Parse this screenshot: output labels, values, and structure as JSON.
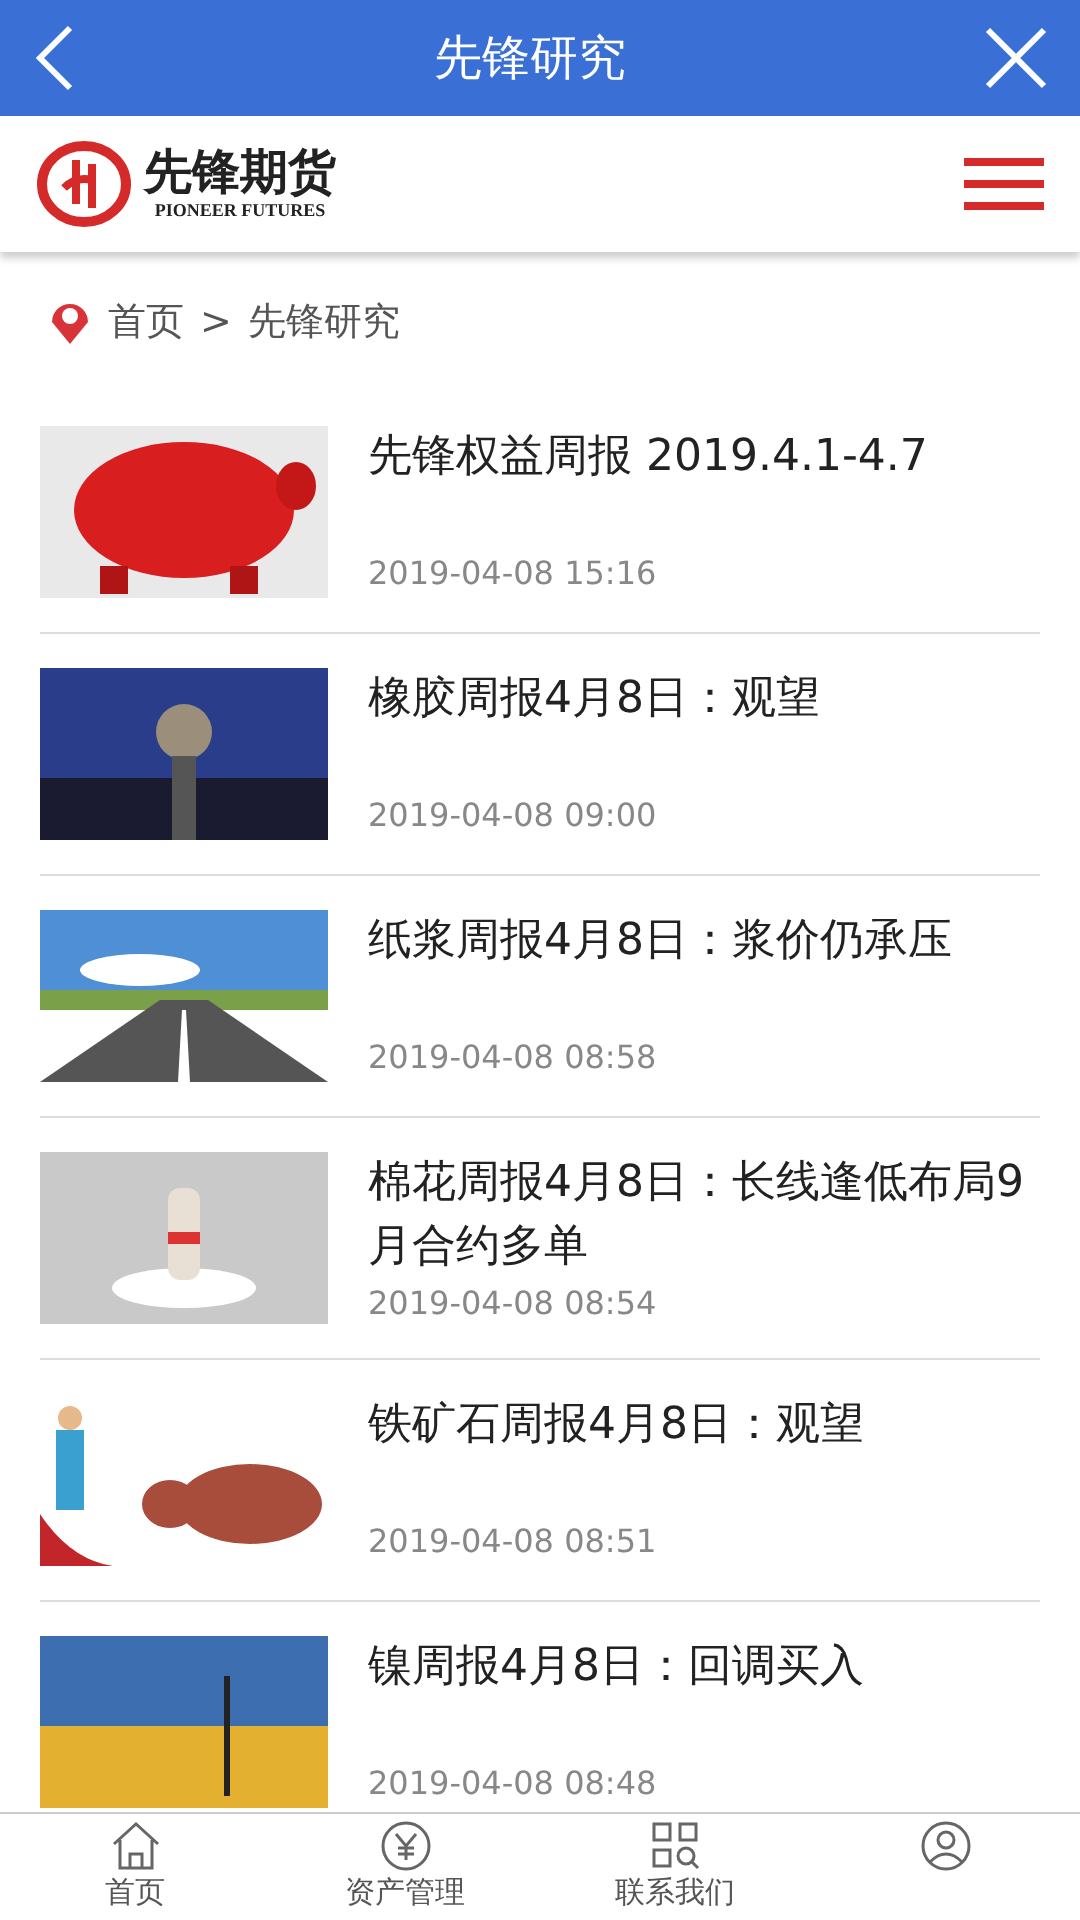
{
  "header": {
    "title": "先锋研究"
  },
  "brand": {
    "name": "先锋期货",
    "subtitle": "PIONEER FUTURES"
  },
  "breadcrumb": {
    "home": "首页",
    "separator": ">",
    "current": "先锋研究"
  },
  "articles": [
    {
      "title": "先锋权益周报 2019.4.1-4.7",
      "date": "2019-04-08 15:16",
      "kind": "piggy"
    },
    {
      "title": "橡胶周报4月8日：观望",
      "date": "2019-04-08 09:00",
      "kind": "city"
    },
    {
      "title": "纸浆周报4月8日：浆价仍承压",
      "date": "2019-04-08 08:58",
      "kind": "road"
    },
    {
      "title": "棉花周报4月8日：长线逢低布局9月合约多单",
      "date": "2019-04-08 08:54",
      "kind": "rocket"
    },
    {
      "title": "铁矿石周报4月8日：观望",
      "date": "2019-04-08 08:51",
      "kind": "bull"
    },
    {
      "title": "镍周报4月8日：回调买入",
      "date": "2019-04-08 08:48",
      "kind": "sunset"
    }
  ],
  "tabbar": [
    {
      "label": "首页",
      "kind": "home"
    },
    {
      "label": "资产管理",
      "kind": "money"
    },
    {
      "label": "联系我们",
      "kind": "grid"
    },
    {
      "kind": "user"
    }
  ]
}
